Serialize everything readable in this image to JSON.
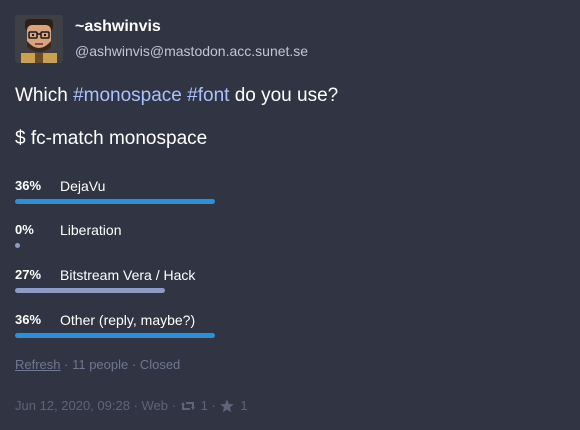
{
  "account": {
    "display_name": "~ashwinvis",
    "handle": "@ashwinvis@mastodon.acc.sunet.se",
    "avatar_icon": "avatar-cartoon-face"
  },
  "content": {
    "line1_prefix": "Which ",
    "hashtag1": "#monospace",
    "between": " ",
    "hashtag2": "#font",
    "line1_suffix": " do you use?",
    "line2": "$ fc-match monospace"
  },
  "poll": {
    "options": [
      {
        "percent_text": "36%",
        "label": "DejaVu",
        "fraction": 0.36,
        "leading": true
      },
      {
        "percent_text": "0%",
        "label": "Liberation",
        "fraction": 0.0,
        "leading": false
      },
      {
        "percent_text": "27%",
        "label": "Bitstream Vera / Hack",
        "fraction": 0.27,
        "leading": false
      },
      {
        "percent_text": "36%",
        "label": "Other (reply, maybe?)",
        "fraction": 0.36,
        "leading": true
      }
    ],
    "refresh_label": "Refresh",
    "voters_text": "11 people",
    "status_text": "Closed",
    "separator": " · "
  },
  "meta": {
    "timestamp": "Jun 12, 2020, 09:28",
    "application": "Web",
    "separator": " · ",
    "boost_count": "1",
    "favourite_count": "1",
    "boost_icon": "boost-icon",
    "favourite_icon": "star-icon"
  },
  "colors": {
    "background": "#313543",
    "leading_bar": "#2b90d9",
    "other_bar": "#8c9bc8",
    "hashtag": "#a9c2ff",
    "muted_text": "#6e7691"
  }
}
